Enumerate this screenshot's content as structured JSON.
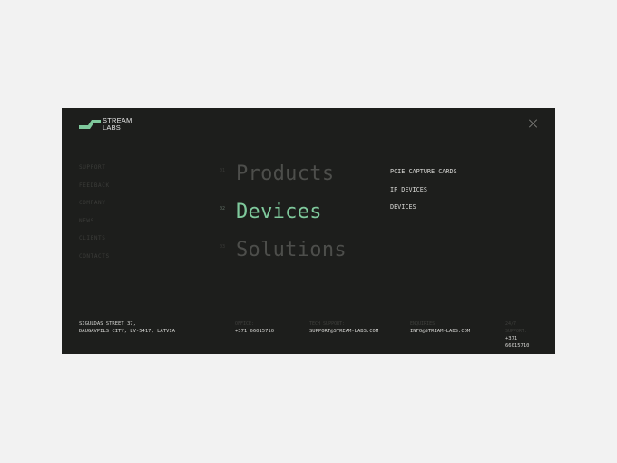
{
  "brand": {
    "logo_line1": "STREAM",
    "logo_line2": "LABS",
    "accent_color": "#7fc99c"
  },
  "close_icon": "close-icon",
  "side_nav": [
    "SUPPORT",
    "FEEDBACK",
    "COMPANY",
    "NEWS",
    "CLIENTS",
    "CONTACTS"
  ],
  "main_nav": [
    {
      "number": "01",
      "label": "Products",
      "active": false
    },
    {
      "number": "02",
      "label": "Devices",
      "active": true
    },
    {
      "number": "03",
      "label": "Solutions",
      "active": false
    }
  ],
  "sub_nav": [
    "PCIE CAPTURE CARDS",
    "IP DEVICES",
    "DEVICES"
  ],
  "footer": {
    "address_line1": "SIGULDAS STREET 37,",
    "address_line2": "DAUGAVPILS CITY, LV-5417, LATVIA",
    "columns": [
      {
        "caption": "OFFICE:",
        "value": "+371 66015710"
      },
      {
        "caption": "TECH SUPPORT:",
        "value": "SUPPORT@STREAM-LABS.COM"
      },
      {
        "caption": "ENQUIRIES:",
        "value": "INFO@STREAM-LABS.COM"
      },
      {
        "caption": "24/7 SUPPORT:",
        "value": "+371 66015710"
      }
    ]
  }
}
